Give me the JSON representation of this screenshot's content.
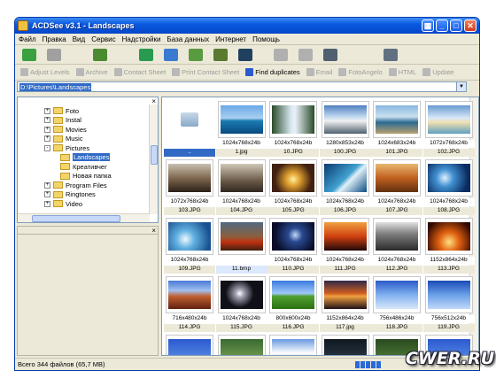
{
  "window": {
    "title": "ACDSee v3.1 - Landscapes"
  },
  "menu": [
    "Файл",
    "Правка",
    "Вид",
    "Сервис",
    "Надстройки",
    "База данных",
    "Интернет",
    "Помощь"
  ],
  "toolbar2": [
    {
      "label": "Adjust Levels",
      "active": false
    },
    {
      "label": "Archive",
      "active": false
    },
    {
      "label": "Contact Sheet",
      "active": false
    },
    {
      "label": "Print Contact Sheet",
      "active": false
    },
    {
      "label": "Find duplicates",
      "active": true
    },
    {
      "label": "Email",
      "active": false
    },
    {
      "label": "FotoAngelo",
      "active": false
    },
    {
      "label": "HTML",
      "active": false
    },
    {
      "label": "Update",
      "active": false
    }
  ],
  "address": "D:\\Pictures\\Landscapes",
  "tree": [
    {
      "label": "Foto",
      "pm": "+",
      "indent": 0,
      "sel": false
    },
    {
      "label": "Instal",
      "pm": "+",
      "indent": 0,
      "sel": false
    },
    {
      "label": "Movies",
      "pm": "+",
      "indent": 0,
      "sel": false
    },
    {
      "label": "Music",
      "pm": "+",
      "indent": 0,
      "sel": false
    },
    {
      "label": "Pictures",
      "pm": "-",
      "indent": 0,
      "sel": false
    },
    {
      "label": "Landscapes",
      "pm": "",
      "indent": 1,
      "sel": true
    },
    {
      "label": "Креативчег",
      "pm": "",
      "indent": 1,
      "sel": false
    },
    {
      "label": "Новая папка",
      "pm": "",
      "indent": 1,
      "sel": false
    },
    {
      "label": "Program Files",
      "pm": "+",
      "indent": 0,
      "sel": false
    },
    {
      "label": "Ringtones",
      "pm": "+",
      "indent": 0,
      "sel": false
    },
    {
      "label": "Video",
      "pm": "+",
      "indent": 0,
      "sel": false
    }
  ],
  "thumbs": [
    {
      "dim": "",
      "name": "..",
      "kind": "folder",
      "sel": true
    },
    {
      "dim": "1024x768x24b",
      "name": "1.jpg",
      "kind": "sea"
    },
    {
      "dim": "1024x768x24b",
      "name": "10.JPG",
      "kind": "falls"
    },
    {
      "dim": "1280x853x24b",
      "name": "100.JPG",
      "kind": "mount"
    },
    {
      "dim": "1024x683x24b",
      "name": "101.JPG",
      "kind": "coast"
    },
    {
      "dim": "1072x768x24b",
      "name": "102.JPG",
      "kind": "beach"
    },
    {
      "dim": "1072x768x24b",
      "name": "103.JPG",
      "kind": "rock"
    },
    {
      "dim": "1024x768x24b",
      "name": "104.JPG",
      "kind": "horse"
    },
    {
      "dim": "1024x768x24b",
      "name": "105.JPG",
      "kind": "sunset"
    },
    {
      "dim": "1024x768x24b",
      "name": "106.JPG",
      "kind": "wave"
    },
    {
      "dim": "1024x768x24b",
      "name": "107.JPG",
      "kind": "dune"
    },
    {
      "dim": "1024x768x24b",
      "name": "108.JPG",
      "kind": "wave2"
    },
    {
      "dim": "1024x768x24b",
      "name": "109.JPG",
      "kind": "wave3"
    },
    {
      "dim": "",
      "name": "11.bmp",
      "kind": "fire",
      "hl": true
    },
    {
      "dim": "1024x768x24b",
      "name": "110.JPG",
      "kind": "night"
    },
    {
      "dim": "1024x768x24b",
      "name": "111.JPG",
      "kind": "palm"
    },
    {
      "dim": "1024x768x24b",
      "name": "112.JPG",
      "kind": "palms2"
    },
    {
      "dim": "1152x864x24b",
      "name": "113.JPG",
      "kind": "orange"
    },
    {
      "dim": "716x480x24b",
      "name": "114.JPG",
      "kind": "canyon"
    },
    {
      "dim": "1024x768x24b",
      "name": "115.JPG",
      "kind": "moon"
    },
    {
      "dim": "800x600x24b",
      "name": "116.JPG",
      "kind": "bliss"
    },
    {
      "dim": "1152x864x24b",
      "name": "117.jpg",
      "kind": "dusk"
    },
    {
      "dim": "756x486x24b",
      "name": "118.JPG",
      "kind": "sky"
    },
    {
      "dim": "756x512x24b",
      "name": "119.JPG",
      "kind": "sky2"
    },
    {
      "dim": "",
      "name": "",
      "kind": "blue"
    },
    {
      "dim": "",
      "name": "",
      "kind": "green"
    },
    {
      "dim": "",
      "name": "",
      "kind": "peak"
    },
    {
      "dim": "",
      "name": "",
      "kind": "dark"
    },
    {
      "dim": "",
      "name": "",
      "kind": "forest"
    },
    {
      "dim": "",
      "name": "",
      "kind": "blue"
    }
  ],
  "status": {
    "text": "Всего 344 файлов (65,7 MB)"
  },
  "watermark": "CWER.RU"
}
